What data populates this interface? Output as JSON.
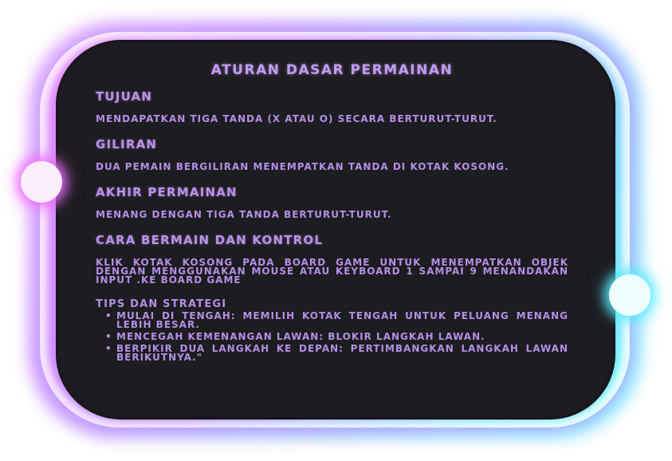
{
  "rules": {
    "title": "Aturan Dasar Permainan",
    "sections": [
      {
        "heading": "Tujuan",
        "text": "Mendapatkan tiga tanda (X atau O) secara berturut-turut."
      },
      {
        "heading": "Giliran",
        "text": "Dua pemain bergiliran menempatkan tanda di kotak kosong."
      },
      {
        "heading": "Akhir Permainan",
        "text": "Menang dengan tiga tanda berturut-turut."
      },
      {
        "heading": "Cara Bermain dan Kontrol",
        "text": "Klik kotak kosong pada board game untuk menempatkan objek dengan menggunakan mouse atau keyboard 1 sampai 9 menandakan input .ke board game"
      }
    ],
    "tips_heading": "Tips dan Strategi",
    "tips": [
      "Mulai di Tengah: Memilih kotak tengah untuk peluang menang lebih besar.",
      "Mencegah Kemenangan Lawan: Blokir langkah lawan.",
      "Berpikir Dua Langkah ke Depan: Pertimbangkan langkah lawan berikutnya.\""
    ]
  },
  "colors": {
    "panel": "#1d1c20",
    "text": "#b38fe6",
    "glow_pink": "#e070ff",
    "glow_cyan": "#5aebff"
  }
}
